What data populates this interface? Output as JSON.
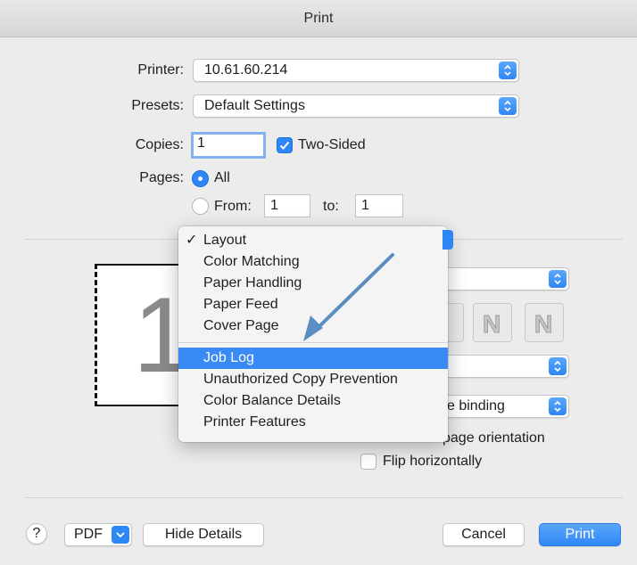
{
  "window": {
    "title": "Print"
  },
  "printer": {
    "label": "Printer:",
    "value": "10.61.60.214"
  },
  "presets": {
    "label": "Presets:",
    "value": "Default Settings"
  },
  "copies": {
    "label": "Copies:",
    "value": "1",
    "two_sided_label": "Two-Sided",
    "two_sided_checked": true
  },
  "pages": {
    "label": "Pages:",
    "all_label": "All",
    "from_label": "From:",
    "from_value": "1",
    "to_label": "to:",
    "to_value": "1"
  },
  "preview": {
    "page_number": "1"
  },
  "menu": {
    "items_top": [
      {
        "label": "Layout",
        "checked": true
      },
      {
        "label": "Color Matching"
      },
      {
        "label": "Paper Handling"
      },
      {
        "label": "Paper Feed"
      },
      {
        "label": "Cover Page"
      }
    ],
    "items_bottom": [
      {
        "label": "Job Log",
        "selected": true
      },
      {
        "label": "Unauthorized Copy Prevention"
      },
      {
        "label": "Color Balance Details"
      },
      {
        "label": "Printer Features"
      }
    ],
    "checkmark": "✓"
  },
  "layout_options": {
    "binding_value": "e binding",
    "reverse_label": "page orientation",
    "flip_label": "Flip horizontally"
  },
  "footer": {
    "help_label": "?",
    "pdf_label": "PDF",
    "hide_details_label": "Hide Details",
    "cancel_label": "Cancel",
    "print_label": "Print"
  },
  "colors": {
    "accent": "#2f86f5",
    "menu_highlight": "#3a8af5",
    "annotation_arrow": "#5b8ec0"
  }
}
